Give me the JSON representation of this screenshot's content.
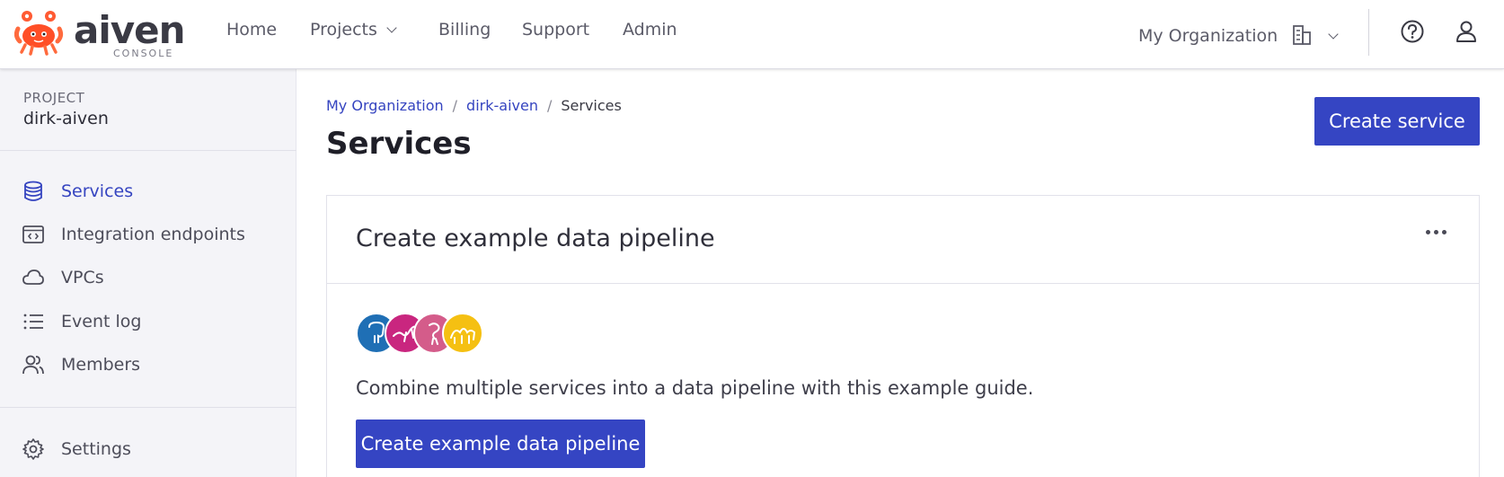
{
  "brand": {
    "name": "aiven",
    "sub": "CONSOLE",
    "accent": "#3545c3"
  },
  "nav": {
    "home": "Home",
    "projects": "Projects",
    "billing": "Billing",
    "support": "Support",
    "admin": "Admin",
    "organization": "My Organization"
  },
  "sidebar": {
    "project_label": "PROJECT",
    "project_name": "dirk-aiven",
    "items": [
      {
        "label": "Services",
        "icon": "database-icon",
        "active": true
      },
      {
        "label": "Integration endpoints",
        "icon": "code-window-icon"
      },
      {
        "label": "VPCs",
        "icon": "cloud-icon"
      },
      {
        "label": "Event log",
        "icon": "list-icon"
      },
      {
        "label": "Members",
        "icon": "users-icon"
      },
      {
        "label": "Settings",
        "icon": "gear-icon"
      }
    ]
  },
  "breadcrumb": [
    "My Organization",
    "dirk-aiven",
    "Services"
  ],
  "page_title": "Services",
  "create_service_label": "Create service",
  "pipeline_card": {
    "title": "Create example data pipeline",
    "description": "Combine multiple services into a data pipeline with this example guide.",
    "button_label": "Create example data pipeline",
    "service_logos": [
      "postgresql-icon",
      "kafka-icon",
      "opensearch-icon",
      "clickhouse-icon"
    ]
  }
}
